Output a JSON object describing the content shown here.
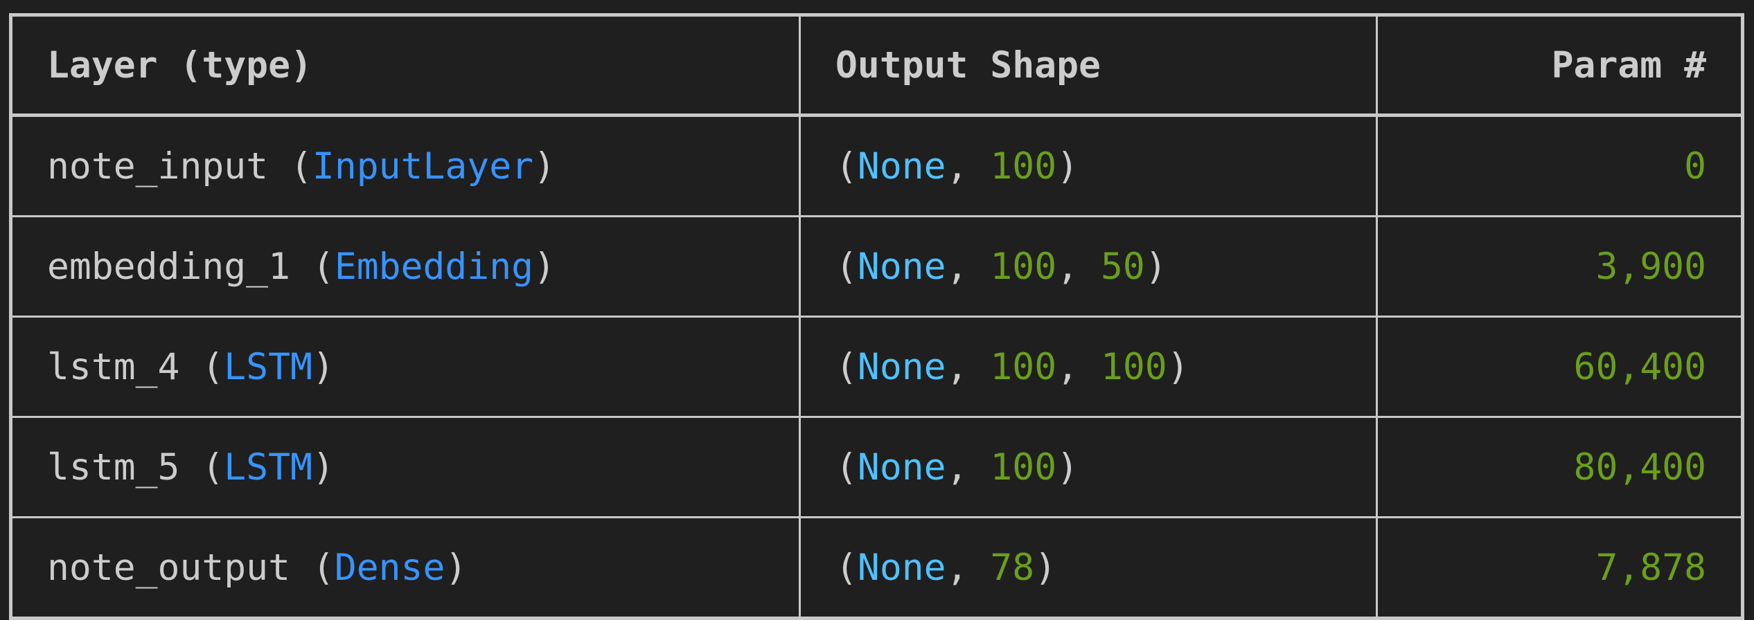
{
  "headers": {
    "layer": "Layer (type)",
    "output": "Output Shape",
    "params": "Param #"
  },
  "rows": [
    {
      "name": "note_input",
      "type": "InputLayer",
      "none": "None",
      "dims": "100",
      "params": "0"
    },
    {
      "name": "embedding_1",
      "type": "Embedding",
      "none": "None",
      "dims": "100, 50",
      "params": "3,900"
    },
    {
      "name": "lstm_4",
      "type": "LSTM",
      "none": "None",
      "dims": "100, 100",
      "params": "60,400"
    },
    {
      "name": "lstm_5",
      "type": "LSTM",
      "none": "None",
      "dims": "100",
      "params": "80,400"
    },
    {
      "name": "note_output",
      "type": "Dense",
      "none": "None",
      "dims": "78",
      "params": "7,878"
    }
  ],
  "colors": {
    "background": "#1f1f1f",
    "border": "#c8c8c8",
    "text": "#cccccc",
    "type": "#3794ff",
    "none": "#4fc1ff",
    "number": "#6a9f1c"
  }
}
